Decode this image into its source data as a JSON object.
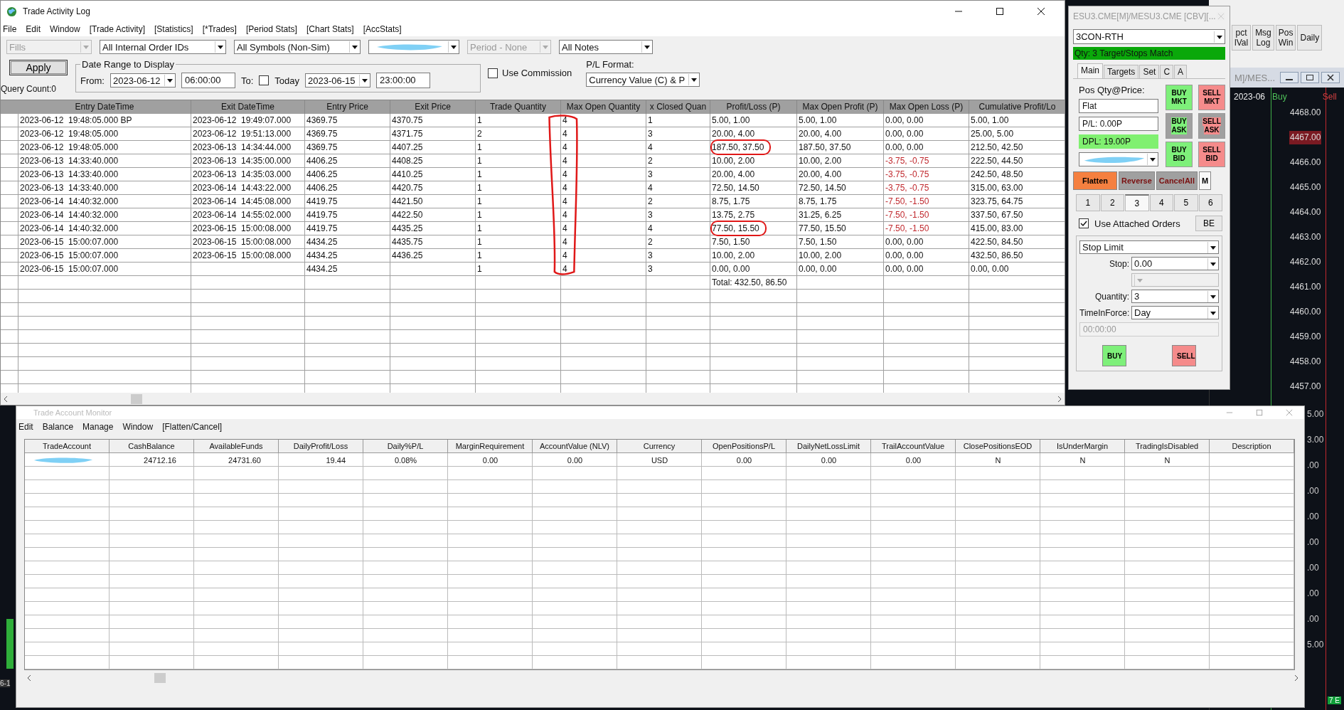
{
  "trade_log": {
    "title": "Trade Activity Log",
    "menu": [
      "File",
      "Edit",
      "Window",
      "[Trade Activity]",
      "[Statistics]",
      "[*Trades]",
      "[Period Stats]",
      "[Chart Stats]",
      "[AccStats]"
    ],
    "filters": [
      {
        "kind": "select",
        "value": "Fills",
        "disabled": true
      },
      {
        "kind": "select",
        "value": "All Internal Order IDs",
        "disabled": false
      },
      {
        "kind": "select",
        "value": "All Symbols (Non-Sim)",
        "disabled": false
      },
      {
        "kind": "redacted",
        "disabled": false
      },
      {
        "kind": "select",
        "value": "Period - None",
        "disabled": true
      },
      {
        "kind": "select",
        "value": "All Notes",
        "disabled": false
      }
    ],
    "apply": "Apply",
    "query_count": "Query Count:0",
    "date_range": {
      "legend": "Date Range to Display",
      "from_label": "From:",
      "from_date": "2023-06-12",
      "from_time": "06:00:00",
      "to_label": "To:",
      "today": {
        "label": "Today",
        "checked": false
      },
      "to_date": "2023-06-15",
      "to_time": "23:00:00"
    },
    "use_commission": {
      "label": "Use Commission",
      "checked": false
    },
    "pl_format": {
      "label": "P/L Format:",
      "value": "Currency Value (C) & P"
    },
    "table": {
      "columns": [
        "Entry DateTime",
        "Exit DateTime",
        "Entry Price",
        "Exit Price",
        "Trade Quantity",
        "Max Open Quantity",
        "x Closed Quan",
        "Profit/Loss (P)",
        "Max Open Profit (P)",
        "Max Open Loss (P)",
        "Cumulative Profit/Lo"
      ],
      "max_open_quantity_circled": true,
      "rows": [
        {
          "cells": [
            "2023-06-12  19:48:05.000 BP",
            "2023-06-12  19:49:07.000",
            "4369.75",
            "4370.75",
            "1",
            "4",
            "1",
            "5.00, 1.00",
            "5.00, 1.00",
            "0.00, 0.00",
            "5.00, 1.00"
          ],
          "loss_negative": false,
          "pl_circled": false
        },
        {
          "cells": [
            "2023-06-12  19:48:05.000",
            "2023-06-12  19:51:13.000",
            "4369.75",
            "4371.75",
            "2",
            "4",
            "3",
            "20.00, 4.00",
            "20.00, 4.00",
            "0.00, 0.00",
            "25.00, 5.00"
          ],
          "loss_negative": false,
          "pl_circled": false
        },
        {
          "cells": [
            "2023-06-12  19:48:05.000",
            "2023-06-13  14:34:44.000",
            "4369.75",
            "4407.25",
            "1",
            "4",
            "4",
            "187.50, 37.50",
            "187.50, 37.50",
            "0.00, 0.00",
            "212.50, 42.50"
          ],
          "loss_negative": false,
          "pl_circled": true
        },
        {
          "cells": [
            "2023-06-13  14:33:40.000",
            "2023-06-13  14:35:00.000",
            "4406.25",
            "4408.25",
            "1",
            "4",
            "2",
            "10.00, 2.00",
            "10.00, 2.00",
            "-3.75, -0.75",
            "222.50, 44.50"
          ],
          "loss_negative": true,
          "pl_circled": false
        },
        {
          "cells": [
            "2023-06-13  14:33:40.000",
            "2023-06-13  14:35:03.000",
            "4406.25",
            "4410.25",
            "1",
            "4",
            "3",
            "20.00, 4.00",
            "20.00, 4.00",
            "-3.75, -0.75",
            "242.50, 48.50"
          ],
          "loss_negative": true,
          "pl_circled": false
        },
        {
          "cells": [
            "2023-06-13  14:33:40.000",
            "2023-06-14  14:43:22.000",
            "4406.25",
            "4420.75",
            "1",
            "4",
            "4",
            "72.50, 14.50",
            "72.50, 14.50",
            "-3.75, -0.75",
            "315.00, 63.00"
          ],
          "loss_negative": true,
          "pl_circled": false
        },
        {
          "cells": [
            "2023-06-14  14:40:32.000",
            "2023-06-14  14:45:08.000",
            "4419.75",
            "4421.50",
            "1",
            "4",
            "2",
            "8.75, 1.75",
            "8.75, 1.75",
            "-7.50, -1.50",
            "323.75, 64.75"
          ],
          "loss_negative": true,
          "pl_circled": false
        },
        {
          "cells": [
            "2023-06-14  14:40:32.000",
            "2023-06-14  14:55:02.000",
            "4419.75",
            "4422.50",
            "1",
            "4",
            "3",
            "13.75, 2.75",
            "31.25, 6.25",
            "-7.50, -1.50",
            "337.50, 67.50"
          ],
          "loss_negative": true,
          "pl_circled": false
        },
        {
          "cells": [
            "2023-06-14  14:40:32.000",
            "2023-06-15  15:00:08.000",
            "4419.75",
            "4435.25",
            "1",
            "4",
            "4",
            "77.50, 15.50",
            "77.50, 15.50",
            "-7.50, -1.50",
            "415.00, 83.00"
          ],
          "loss_negative": true,
          "pl_circled": true
        },
        {
          "cells": [
            "2023-06-15  15:00:07.000",
            "2023-06-15  15:00:08.000",
            "4434.25",
            "4435.75",
            "1",
            "4",
            "2",
            "7.50, 1.50",
            "7.50, 1.50",
            "0.00, 0.00",
            "422.50, 84.50"
          ],
          "loss_negative": false,
          "pl_circled": false
        },
        {
          "cells": [
            "2023-06-15  15:00:07.000",
            "2023-06-15  15:00:08.000",
            "4434.25",
            "4436.25",
            "1",
            "4",
            "3",
            "10.00, 2.00",
            "10.00, 2.00",
            "0.00, 0.00",
            "432.50, 86.50"
          ],
          "loss_negative": false,
          "pl_circled": false
        },
        {
          "cells": [
            "2023-06-15  15:00:07.000",
            "",
            "4434.25",
            "",
            "1",
            "4",
            "3",
            "0.00, 0.00",
            "0.00, 0.00",
            "0.00, 0.00",
            "0.00, 0.00"
          ],
          "loss_negative": false,
          "pl_circled": false
        }
      ],
      "total": "Total: 432.50, 86.50"
    }
  },
  "order_panel": {
    "title": "ESU3.CME[M]/MESU3.CME [CBV][...",
    "config": "3CON-RTH",
    "status": "Qty: 3 Target/Stops Match",
    "tabs": [
      {
        "label": "Main",
        "selected": true
      },
      {
        "label": "Targets",
        "selected": false
      },
      {
        "label": "Set",
        "selected": false
      },
      {
        "label": "C",
        "selected": false
      },
      {
        "label": "A",
        "selected": false
      }
    ],
    "pos_label": "Pos Qty@Price:",
    "position": "Flat",
    "pl": "P/L: 0.00P",
    "dpl": "DPL: 19.00P",
    "trade_buttons": [
      {
        "lines": [
          "BUY",
          "MKT"
        ],
        "kind": "buy"
      },
      {
        "lines": [
          "SELL",
          "MKT"
        ],
        "kind": "sell"
      },
      {
        "lines": [
          "BUY",
          "ASK"
        ],
        "kind": "buyframed"
      },
      {
        "lines": [
          "SELL",
          "ASK"
        ],
        "kind": "sellframed"
      },
      {
        "lines": [
          "BUY",
          "BID"
        ],
        "kind": "buy"
      },
      {
        "lines": [
          "SELL",
          "BID"
        ],
        "kind": "sell"
      }
    ],
    "actions": [
      {
        "label": "Flatten",
        "kind": "flatten"
      },
      {
        "label": "Reverse",
        "kind": "framed"
      },
      {
        "label": "CancelAll",
        "kind": "framed"
      },
      {
        "label": "M",
        "kind": "plain"
      }
    ],
    "presets": [
      {
        "label": "1",
        "selected": false
      },
      {
        "label": "2",
        "selected": false
      },
      {
        "label": "3",
        "selected": true
      },
      {
        "label": "4",
        "selected": false
      },
      {
        "label": "5",
        "selected": false
      },
      {
        "label": "6",
        "selected": false
      }
    ],
    "attached": {
      "label": "Use Attached Orders",
      "checked": true
    },
    "be": "BE",
    "order_type": "Stop Limit",
    "stop_label": "Stop:",
    "stop": "0.00",
    "quantity_label": "Quantity:",
    "quantity": "3",
    "tif_label": "TimeInForce:",
    "tif": "Day",
    "time": "00:00:00",
    "buy": "BUY",
    "sell": "SELL"
  },
  "chart": {
    "toolbar": [
      {
        "lines": [
          "pct",
          "lVal"
        ]
      },
      {
        "lines": [
          "Msg",
          "Log"
        ]
      },
      {
        "lines": [
          "Pos",
          "Win"
        ]
      },
      {
        "lines": [
          "Daily"
        ]
      }
    ],
    "window_title": "M]/MES...",
    "date": "2023-06",
    "buy": "Buy",
    "sell": "Sell",
    "prices": [
      {
        "value": "4468.00",
        "highlighted": false
      },
      {
        "value": "4467.00",
        "highlighted": true
      },
      {
        "value": "4466.00",
        "highlighted": false
      },
      {
        "value": "4465.00",
        "highlighted": false
      },
      {
        "value": "4464.00",
        "highlighted": false
      },
      {
        "value": "4463.00",
        "highlighted": false
      },
      {
        "value": "4462.00",
        "highlighted": false
      },
      {
        "value": "4461.00",
        "highlighted": false
      },
      {
        "value": "4460.00",
        "highlighted": false
      },
      {
        "value": "4459.00",
        "highlighted": false
      },
      {
        "value": "4458.00",
        "highlighted": false
      },
      {
        "value": "4457.00",
        "highlighted": false
      }
    ],
    "lower_prices": [
      "5.00",
      "3.00",
      ".00",
      ".00",
      ".00",
      ".00",
      ".00",
      ".00",
      ".00",
      "5.00"
    ],
    "corner_label": "7 E",
    "left_label": "6-1"
  },
  "account_monitor": {
    "title": "Trade Account Monitor",
    "menu": [
      "Edit",
      "Balance",
      "Manage",
      "Window",
      "[Flatten/Cancel]"
    ],
    "columns": [
      "TradeAccount",
      "CashBalance",
      "AvailableFunds",
      "DailyProfit/Loss",
      "Daily%P/L",
      "MarginRequirement",
      "AccountValue (NLV)",
      "Currency",
      "OpenPositionsP/L",
      "DailyNetLossLimit",
      "TrailAccountValue",
      "ClosePositionsEOD",
      "IsUnderMargin",
      "TradingIsDisabled",
      "Description"
    ],
    "rows": [
      {
        "account_redacted": true,
        "cells": [
          "",
          "24712.16",
          "24731.60",
          "19.44",
          "0.08%",
          "0.00",
          "0.00",
          "USD",
          "0.00",
          "0.00",
          "0.00",
          "N",
          "N",
          "N"
        ]
      }
    ]
  }
}
